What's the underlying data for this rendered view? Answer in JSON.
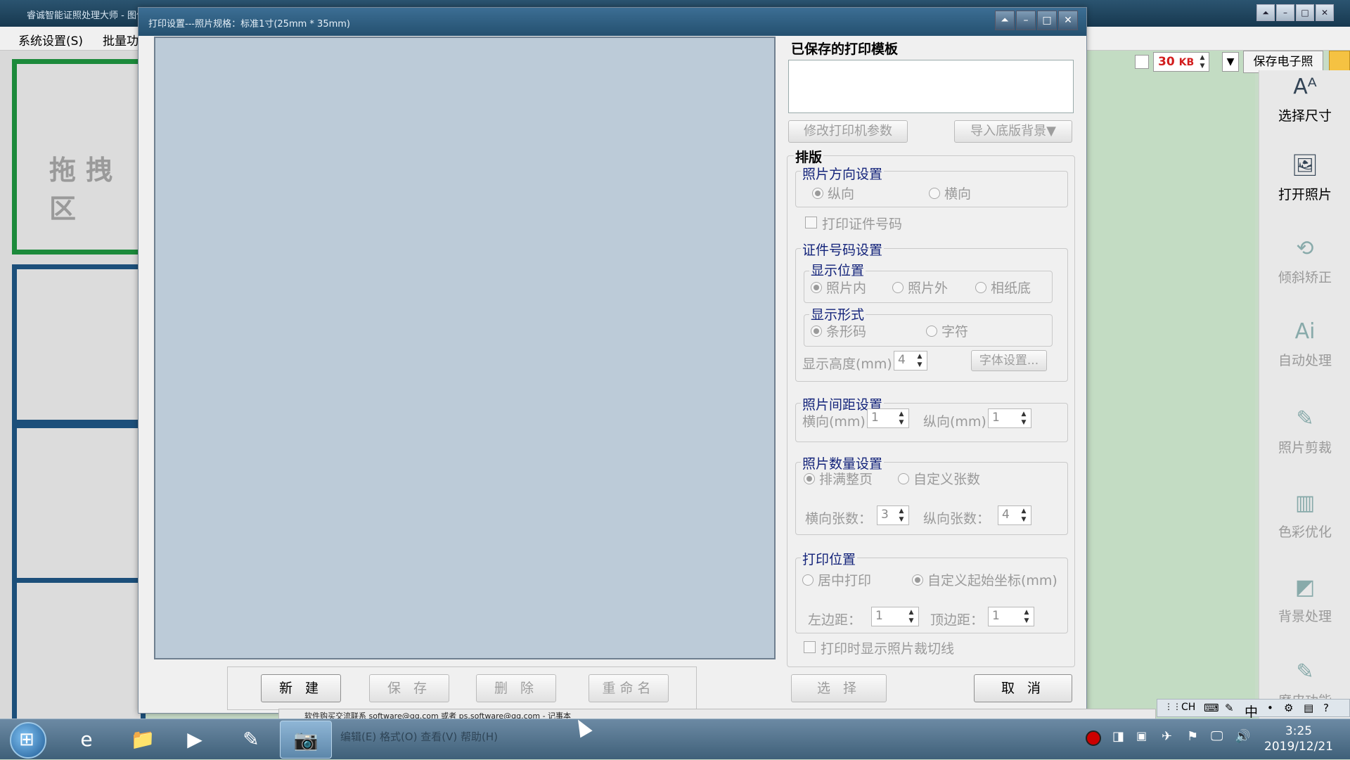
{
  "bg_app": {
    "title": "睿诚智能证照处理大师 - 图像",
    "menu": [
      "系统设置(S)",
      "批量功"
    ],
    "drop_hint": "拖拽区",
    "size_kb": "30",
    "size_unit": "KB",
    "save_photo": "保存电子照",
    "tools": [
      "选择尺寸",
      "打开照片",
      "倾斜矫正",
      "自动处理",
      "照片剪裁",
      "色彩优化",
      "背景处理",
      "磨皮功能"
    ]
  },
  "dialog": {
    "title": "打印设置---照片规格：标准1寸(25mm * 35mm)",
    "saved_templates_label": "已保存的打印模板",
    "modify_printer": "修改打印机参数",
    "import_bg": "导入底版背景▼",
    "layout_label": "排版",
    "orientation": {
      "title": "照片方向设置",
      "portrait": "纵向",
      "landscape": "横向"
    },
    "print_id_checkbox": "打印证件号码",
    "id_settings": {
      "title": "证件号码设置",
      "position_title": "显示位置",
      "pos_options": [
        "照片内",
        "照片外",
        "相纸底"
      ],
      "form_title": "显示形式",
      "form_options": [
        "条形码",
        "字符"
      ],
      "height_label": "显示高度(mm)：",
      "height_value": "4",
      "font_btn": "字体设置..."
    },
    "spacing": {
      "title": "照片间距设置",
      "h_label": "横向(mm)：",
      "h_value": "1",
      "v_label": "纵向(mm)：",
      "v_value": "1"
    },
    "count": {
      "title": "照片数量设置",
      "fill_page": "排满整页",
      "custom": "自定义张数",
      "h_label": "横向张数：",
      "h_value": "3",
      "v_label": "纵向张数：",
      "v_value": "4"
    },
    "position": {
      "title": "打印位置",
      "center": "居中打印",
      "custom": "自定义起始坐标(mm)",
      "left_label": "左边距：",
      "left_value": "1",
      "top_label": "顶边距：",
      "top_value": "1"
    },
    "show_cut_lines": "打印时显示照片裁切线",
    "buttons": {
      "new": "新 建",
      "save": "保 存",
      "delete": "删 除",
      "rename": "重命名",
      "select": "选 择",
      "cancel": "取 消"
    }
  },
  "notification": "软件购买交流联系 software@qq.com 或者 ps.software@qq.com - 记事本",
  "taskbar": {
    "ghost_text": "编辑(E)  格式(O)  查看(V)  帮助(H)",
    "ime": "CH",
    "ime_mode": "中",
    "time": "3:25",
    "date": "2019/12/21"
  },
  "colors": {
    "group_title": "#13237a",
    "drop_green": "#1c8a3b",
    "drop_blue": "#1c4f7a",
    "kb_red": "#d21d1d"
  }
}
